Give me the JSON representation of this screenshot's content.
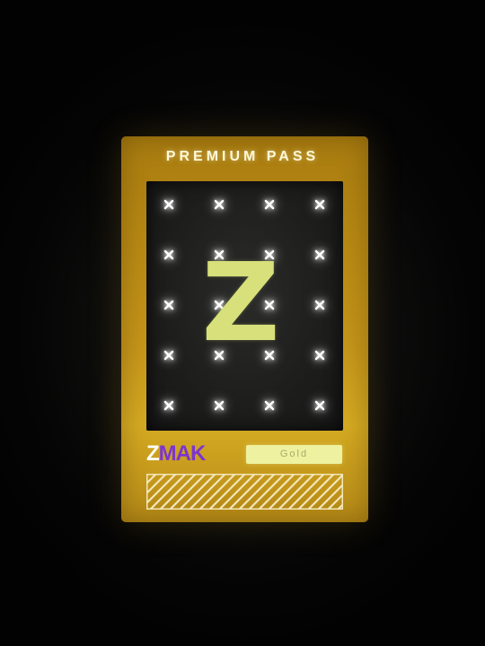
{
  "card": {
    "title": "PREMIUM PASS",
    "letter": "Z",
    "brand_part1": "Z",
    "brand_part2": "MAK",
    "tier": "Gold"
  },
  "colors": {
    "card_gold": "#c6961a",
    "screen_dark": "#1d1d1c",
    "letter_lime": "#d7e07a",
    "badge_bg": "#eef2a0",
    "brand_white": "#ffffff",
    "brand_purple": "#7b35d0",
    "cross_glow": "#ffffff"
  },
  "icons": {
    "grid_marker": "cross-icon",
    "footer_pattern": "diagonal-stripes"
  }
}
